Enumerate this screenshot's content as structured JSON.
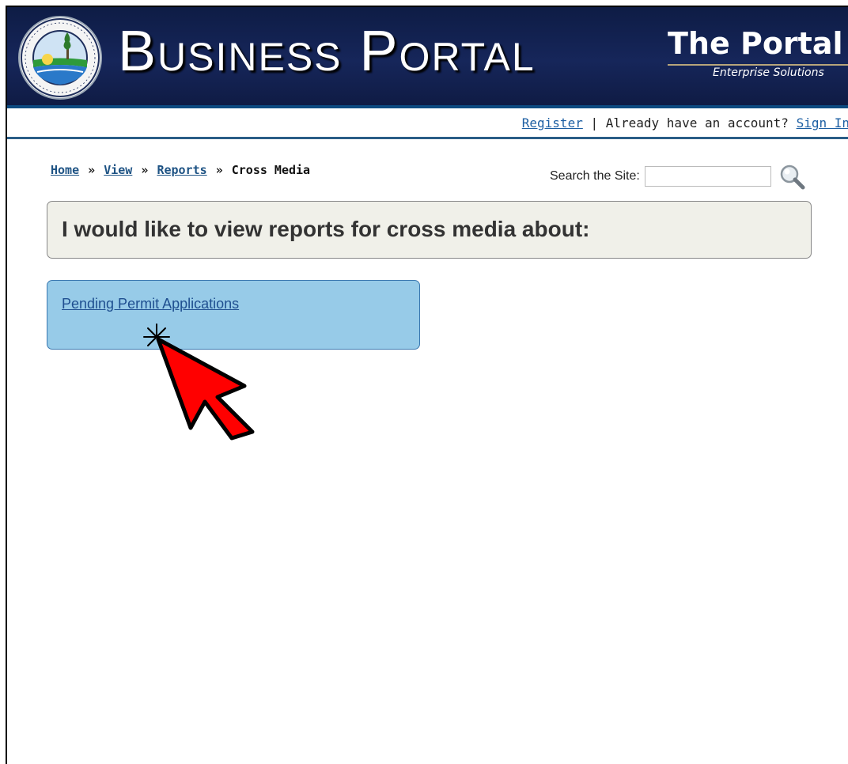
{
  "header": {
    "portal_title": "Business Portal",
    "brand_name": "The Portal",
    "brand_tagline": "Enterprise Solutions",
    "logo_lettering": "Florida Department of Environmental Protection"
  },
  "account_bar": {
    "register_label": "Register",
    "separator": " | ",
    "prompt": "Already have an account? ",
    "sign_in_label": "Sign In"
  },
  "breadcrumb": {
    "items": [
      "Home",
      "View",
      "Reports"
    ],
    "separator": "»",
    "current": "Cross Media"
  },
  "search": {
    "label": "Search the Site:",
    "value": "",
    "button_icon": "magnifier-icon"
  },
  "main": {
    "prompt": "I would like to view reports for cross media about:",
    "options": [
      {
        "label": "Pending Permit Applications"
      }
    ]
  },
  "annotation": {
    "icon": "click-arrow-icon"
  },
  "colors": {
    "header_bg": "#16265a",
    "header_rule": "#0d4a80",
    "link": "#1d5fa3",
    "prompt_bg": "#f0f0e9",
    "option_bg": "#97cbe8",
    "cursor_red": "#ff0000"
  }
}
